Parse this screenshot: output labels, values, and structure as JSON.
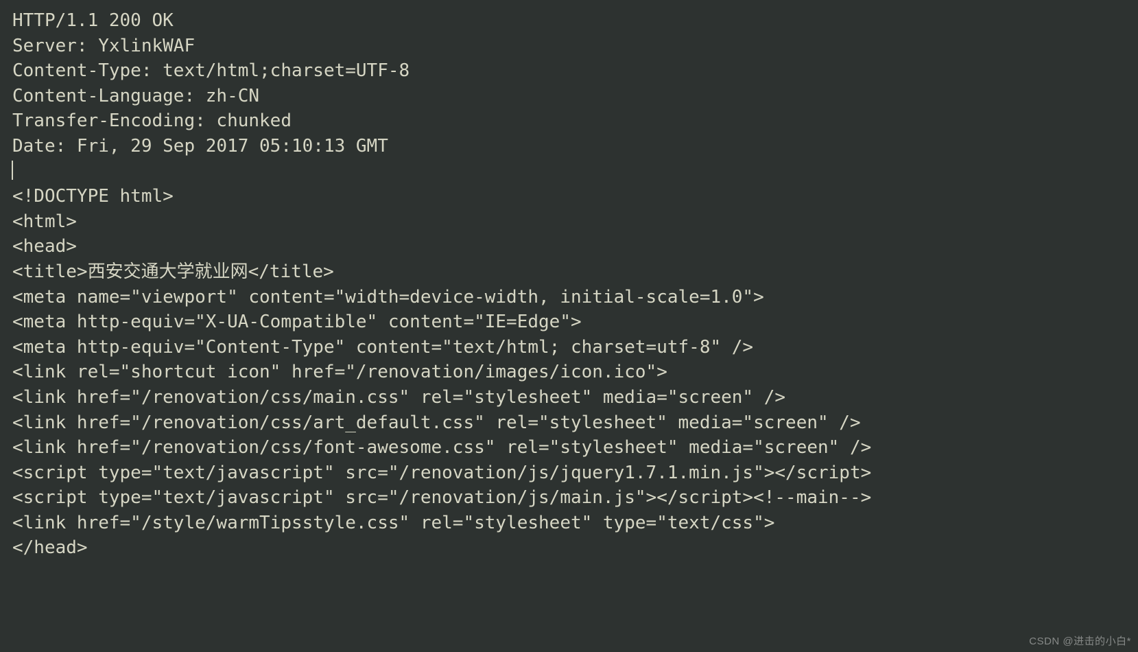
{
  "lines": [
    "HTTP/1.1 200 OK",
    "Server: YxlinkWAF",
    "Content-Type: text/html;charset=UTF-8",
    "Content-Language: zh-CN",
    "Transfer-Encoding: chunked",
    "Date: Fri, 29 Sep 2017 05:10:13 GMT",
    "",
    "<!DOCTYPE html>",
    "<html>",
    "<head>",
    "<title>西安交通大学就业网</title>",
    "<meta name=\"viewport\" content=\"width=device-width, initial-scale=1.0\">",
    "<meta http-equiv=\"X-UA-Compatible\" content=\"IE=Edge\">",
    "<meta http-equiv=\"Content-Type\" content=\"text/html; charset=utf-8\" />",
    "<link rel=\"shortcut icon\" href=\"/renovation/images/icon.ico\">",
    "<link href=\"/renovation/css/main.css\" rel=\"stylesheet\" media=\"screen\" />",
    "<link href=\"/renovation/css/art_default.css\" rel=\"stylesheet\" media=\"screen\" />",
    "<link href=\"/renovation/css/font-awesome.css\" rel=\"stylesheet\" media=\"screen\" />",
    "<script type=\"text/javascript\" src=\"/renovation/js/jquery1.7.1.min.js\"></script>",
    "<script type=\"text/javascript\" src=\"/renovation/js/main.js\"></script><!--main-->",
    "<link href=\"/style/warmTipsstyle.css\" rel=\"stylesheet\" type=\"text/css\">",
    "</head>"
  ],
  "cursor_line": 6,
  "watermark": "CSDN @进击的小白*"
}
